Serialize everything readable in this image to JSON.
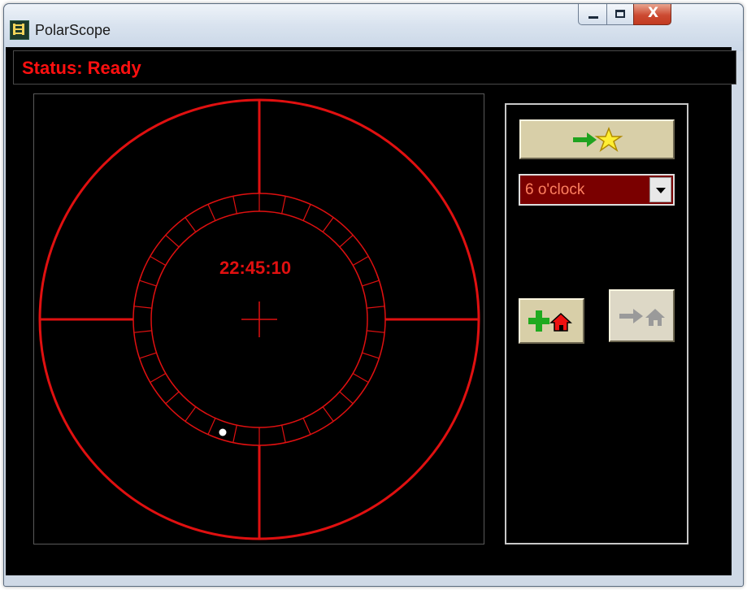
{
  "window": {
    "title": "PolarScope",
    "icon": "polarscope-app-icon",
    "caption_buttons": {
      "minimize": "minimize-icon",
      "maximize": "maximize-icon",
      "close": "close-icon",
      "close_glyph": "X"
    }
  },
  "status": {
    "text": "Status: Ready",
    "color": "#ff1010"
  },
  "reticle": {
    "time": "22:45:10",
    "color": "#e01010",
    "ring_tick_count": 30,
    "polaris_clock_position": "6 o'clock"
  },
  "controls": {
    "goto_star_button": {
      "icons": [
        "arrow-right-green-icon",
        "star-yellow-icon"
      ]
    },
    "orientation_select": {
      "selected": "6 o'clock"
    },
    "add_home_button": {
      "icons": [
        "plus-green-icon",
        "home-red-icon"
      ]
    },
    "goto_home_button": {
      "icons": [
        "arrow-right-gray-icon",
        "home-gray-icon"
      ],
      "enabled": false
    }
  },
  "colors": {
    "background": "#000000",
    "accent": "#e01010",
    "button_face": "#d8cfa8"
  }
}
